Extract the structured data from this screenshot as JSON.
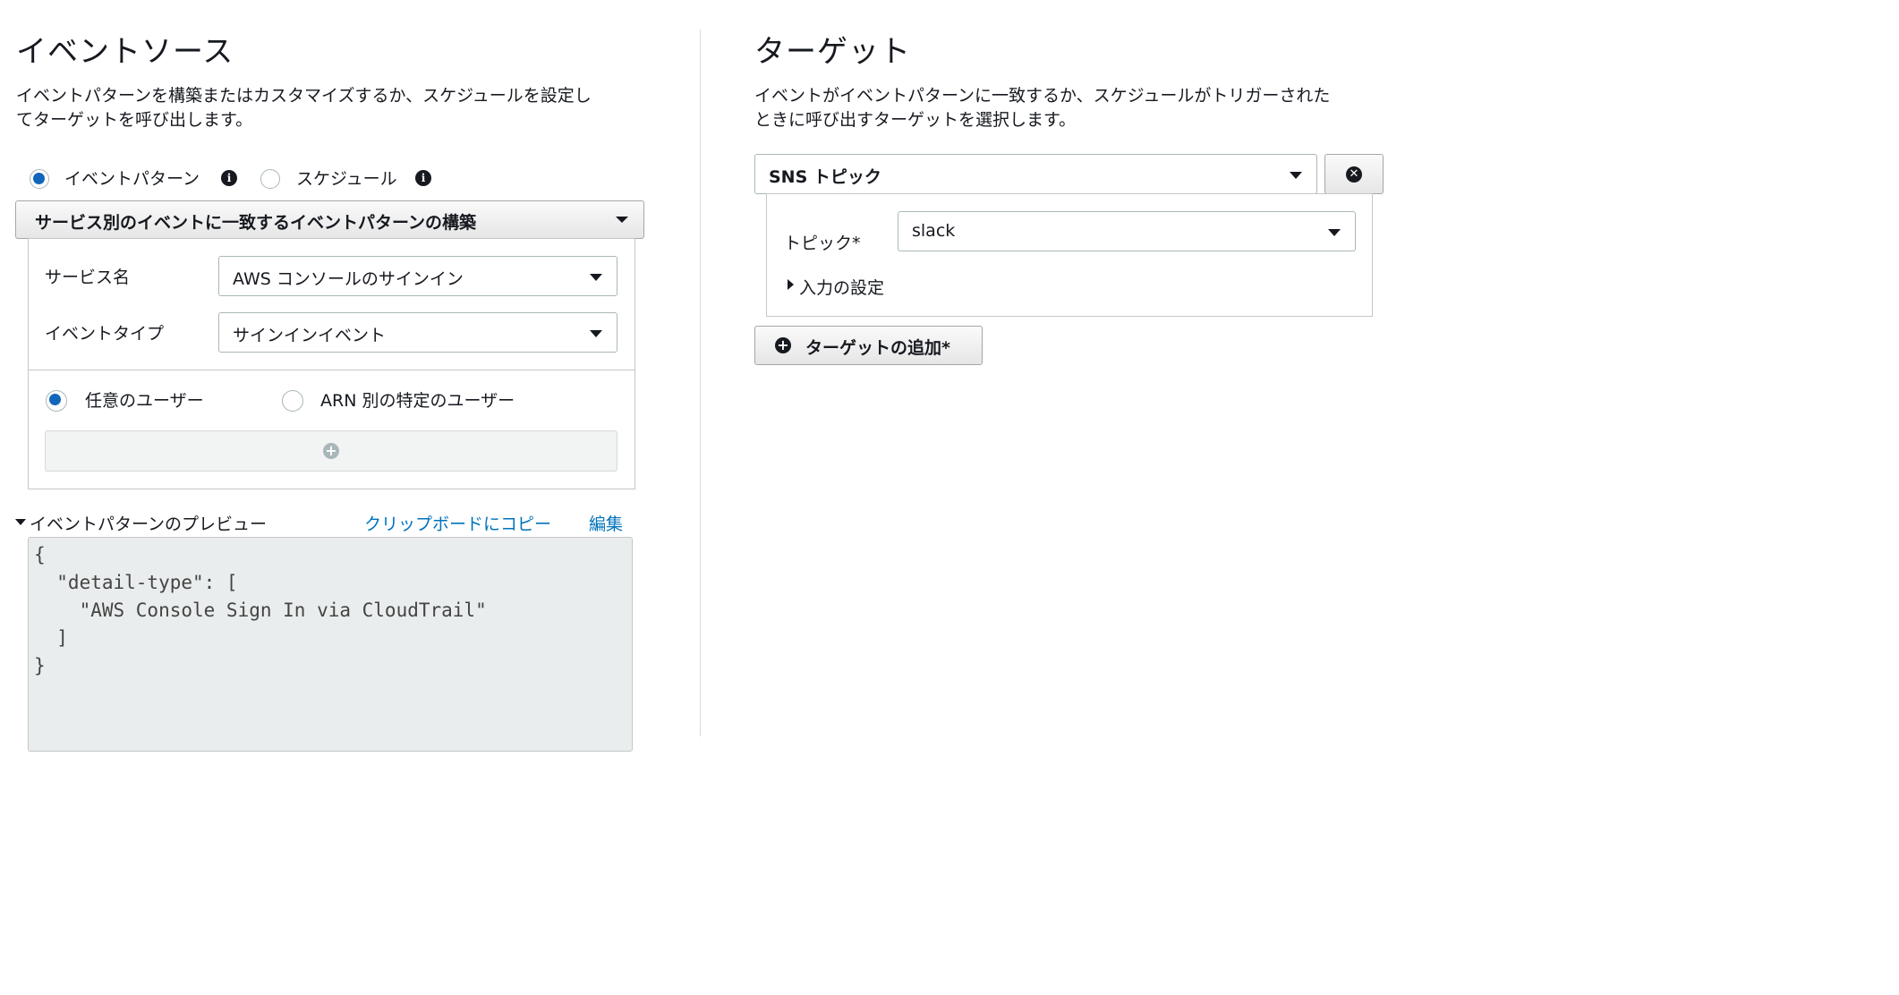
{
  "event_source": {
    "title": "イベントソース",
    "description_line1": "イベントパターンを構築またはカスタマイズするか、スケジュールを設定し",
    "description_line2": "てターゲットを呼び出します。",
    "radio_event_pattern": "イベントパターン",
    "radio_schedule": "スケジュール",
    "pattern_builder_label": "サービス別のイベントに一致するイベントパターンの構築",
    "service_name_label": "サービス名",
    "service_name_value": "AWS コンソールのサインイン",
    "event_type_label": "イベントタイプ",
    "event_type_value": "サインインイベント",
    "radio_any_user": "任意のユーザー",
    "radio_specific_user": "ARN 別の特定のユーザー",
    "preview_label": "イベントパターンのプレビュー",
    "copy_link": "クリップボードにコピー",
    "edit_link": "編集",
    "code_lines": [
      "{",
      "  \"detail-type\": [",
      "    \"AWS Console Sign In via CloudTrail\"",
      "  ]",
      "}"
    ]
  },
  "target": {
    "title": "ターゲット",
    "description_line1": "イベントがイベントパターンに一致するか、スケジュールがトリガーされた",
    "description_line2": "ときに呼び出すターゲットを選択します。",
    "target_type_value": "SNS トピック",
    "topic_label": "トピック*",
    "topic_value": "slack",
    "input_settings": "入力の設定",
    "add_target_button": "ターゲットの追加*"
  },
  "colors": {
    "accent": "#1166bb",
    "link": "#0073bb"
  }
}
